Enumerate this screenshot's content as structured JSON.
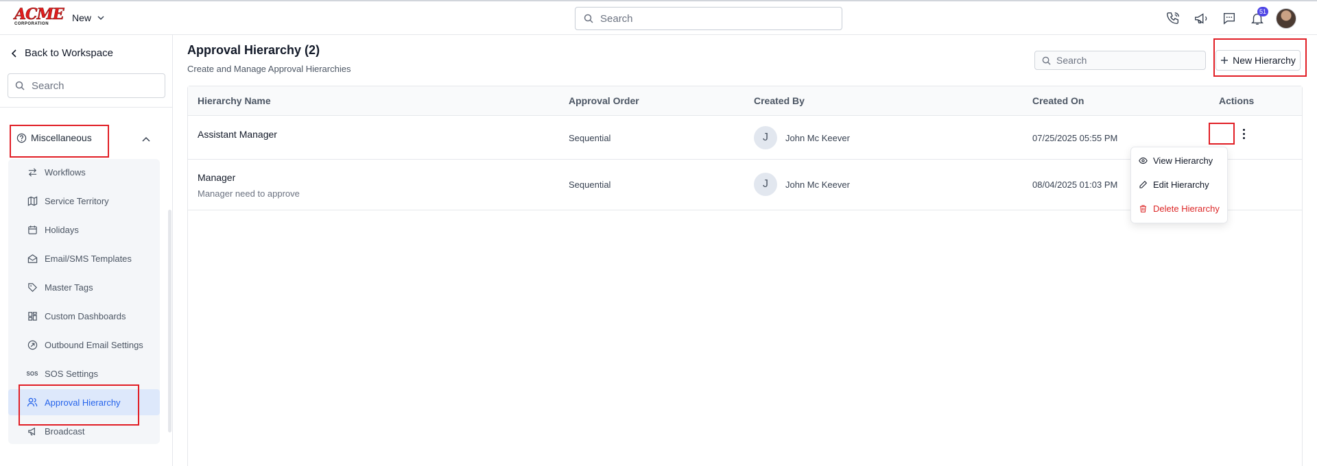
{
  "brand": {
    "logo_text": "ACME",
    "logo_sub": "CORPORATION"
  },
  "topbar": {
    "new_label": "New",
    "search_placeholder": "Search",
    "notification_count": "51",
    "icons": [
      "phone-icon",
      "megaphone-icon",
      "chat-icon",
      "bell-icon",
      "user-avatar"
    ]
  },
  "sidebar": {
    "back_label": "Back to Workspace",
    "search_placeholder": "Search",
    "section_label": "Miscellaneous",
    "items": [
      {
        "label": "Workflows",
        "icon": "arrows-icon"
      },
      {
        "label": "Service Territory",
        "icon": "map-icon"
      },
      {
        "label": "Holidays",
        "icon": "calendar-icon"
      },
      {
        "label": "Email/SMS Templates",
        "icon": "mail-open-icon"
      },
      {
        "label": "Master Tags",
        "icon": "tag-icon"
      },
      {
        "label": "Custom Dashboards",
        "icon": "dashboard-icon"
      },
      {
        "label": "Outbound Email Settings",
        "icon": "outbound-icon"
      },
      {
        "label": "SOS Settings",
        "icon": "sos-icon",
        "icon_text": "SOS"
      },
      {
        "label": "Approval Hierarchy",
        "icon": "users-icon",
        "active": true
      },
      {
        "label": "Broadcast",
        "icon": "megaphone-icon"
      }
    ]
  },
  "main": {
    "title": "Approval Hierarchy (2)",
    "subtitle": "Create and Manage Approval Hierarchies",
    "search_placeholder": "Search",
    "new_button_label": "New Hierarchy",
    "columns": [
      "Hierarchy Name",
      "Approval Order",
      "Created By",
      "Created On",
      "Actions"
    ],
    "rows": [
      {
        "name": "Assistant Manager",
        "description": "",
        "order": "Sequential",
        "initial": "J",
        "created_by": "John Mc Keever",
        "created_on": "07/25/2025 05:55 PM"
      },
      {
        "name": "Manager",
        "description": "Manager need to approve",
        "order": "Sequential",
        "initial": "J",
        "created_by": "John Mc Keever",
        "created_on": "08/04/2025 01:03 PM"
      }
    ],
    "action_menu": {
      "view_label": "View Hierarchy",
      "edit_label": "Edit Hierarchy",
      "delete_label": "Delete Hierarchy"
    }
  },
  "colors": {
    "accent": "#2563eb",
    "danger": "#dc2626",
    "highlight_box": "#e11d24",
    "badge": "#4f46e5"
  }
}
